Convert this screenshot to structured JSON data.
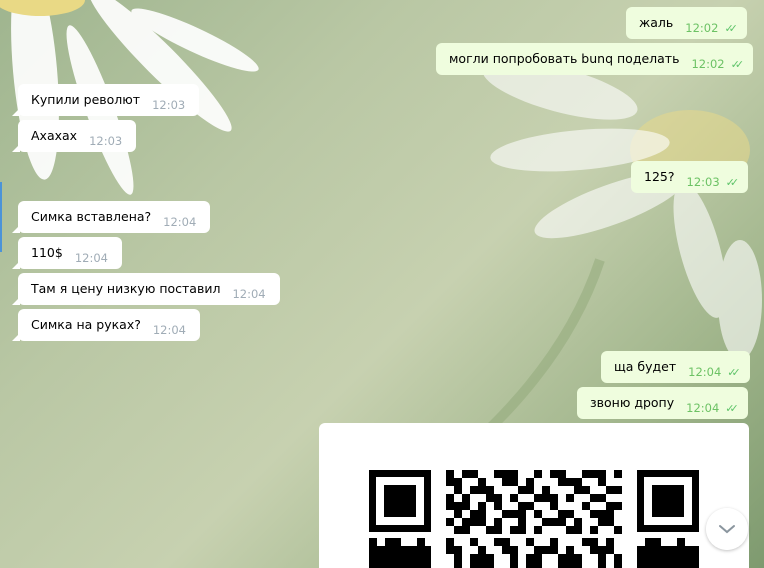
{
  "messages": [
    {
      "text": "жаль",
      "time": "12:02",
      "side": "out"
    },
    {
      "text": "могли попробовать bunq поделать",
      "time": "12:02",
      "side": "out"
    },
    {
      "text": "Купили револют",
      "time": "12:03",
      "side": "in"
    },
    {
      "text": "Ахахах",
      "time": "12:03",
      "side": "in"
    },
    {
      "text": "125?",
      "time": "12:03",
      "side": "out"
    },
    {
      "text": "Симка вставлена?",
      "time": "12:04",
      "side": "in"
    },
    {
      "text": "110$",
      "time": "12:04",
      "side": "in"
    },
    {
      "text": "Там я цену низкую поставил",
      "time": "12:04",
      "side": "in"
    },
    {
      "text": "Симка на руках?",
      "time": "12:04",
      "side": "in"
    },
    {
      "text": "ща будет",
      "time": "12:04",
      "side": "out"
    },
    {
      "text": "звоню дропу",
      "time": "12:04",
      "side": "out"
    }
  ],
  "read_ticks": "✓✓",
  "attachment": {
    "icon": "qr-code-image"
  },
  "scroll_down_icon": "chevron-down-icon",
  "colors": {
    "incoming": "#ffffff",
    "outgoing": "#effdde",
    "tick": "#5fc46a",
    "time": "#a0acb6"
  }
}
